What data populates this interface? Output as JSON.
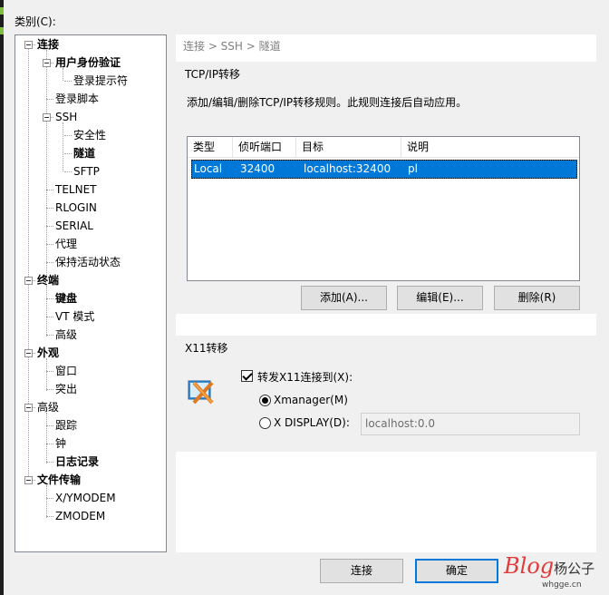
{
  "category_label": "类别(C):",
  "tree": [
    {
      "label": "连接",
      "bold": true,
      "expander": true
    },
    {
      "label": "用户身份验证",
      "bold": true,
      "expander": true
    },
    {
      "label": "登录提示符",
      "bold": false
    },
    {
      "label": "登录脚本",
      "bold": false
    },
    {
      "label": "SSH",
      "bold": false,
      "expander": true
    },
    {
      "label": "安全性",
      "bold": false
    },
    {
      "label": "隧道",
      "bold": true,
      "selected": true
    },
    {
      "label": "SFTP",
      "bold": false
    },
    {
      "label": "TELNET",
      "bold": false
    },
    {
      "label": "RLOGIN",
      "bold": false
    },
    {
      "label": "SERIAL",
      "bold": false
    },
    {
      "label": "代理",
      "bold": false
    },
    {
      "label": "保持活动状态",
      "bold": false
    },
    {
      "label": "终端",
      "bold": true,
      "expander": true
    },
    {
      "label": "键盘",
      "bold": true
    },
    {
      "label": "VT 模式",
      "bold": false
    },
    {
      "label": "高级",
      "bold": false
    },
    {
      "label": "外观",
      "bold": true,
      "expander": true
    },
    {
      "label": "窗口",
      "bold": false
    },
    {
      "label": "突出",
      "bold": false
    },
    {
      "label": "高级",
      "bold": false,
      "expander": true
    },
    {
      "label": "跟踪",
      "bold": false
    },
    {
      "label": "钟",
      "bold": false
    },
    {
      "label": "日志记录",
      "bold": true
    },
    {
      "label": "文件传输",
      "bold": true,
      "expander": true
    },
    {
      "label": "X/YMODEM",
      "bold": false
    },
    {
      "label": "ZMODEM",
      "bold": false
    }
  ],
  "breadcrumb": "连接 > SSH > 隧道",
  "tcp": {
    "title": "TCP/IP转移",
    "description": "添加/编辑/删除TCP/IP转移规则。此规则连接后自动应用。",
    "columns": [
      "类型",
      "侦听端口",
      "目标",
      "说明"
    ],
    "rows": [
      [
        "Local",
        "32400",
        "localhost:32400",
        "pl"
      ]
    ],
    "add_button": "添加(A)...",
    "edit_button": "编辑(E)...",
    "delete_button": "删除(R)"
  },
  "x11": {
    "title": "X11转移",
    "forward_label": "转发X11连接到(X):",
    "forward_checked": true,
    "xmanager_label": "Xmanager(M)",
    "xdisplay_label": "X DISPLAY(D):",
    "xdisplay_value": "localhost:0.0",
    "selected": "xmanager"
  },
  "footer": {
    "connect_button": "连接",
    "ok_button": "确定"
  },
  "watermark": {
    "blog": "Blog",
    "name": "杨公子",
    "site": "whgge.cn"
  },
  "colors": {
    "selection": "#0078d7",
    "accent_red": "#e23a3a"
  }
}
